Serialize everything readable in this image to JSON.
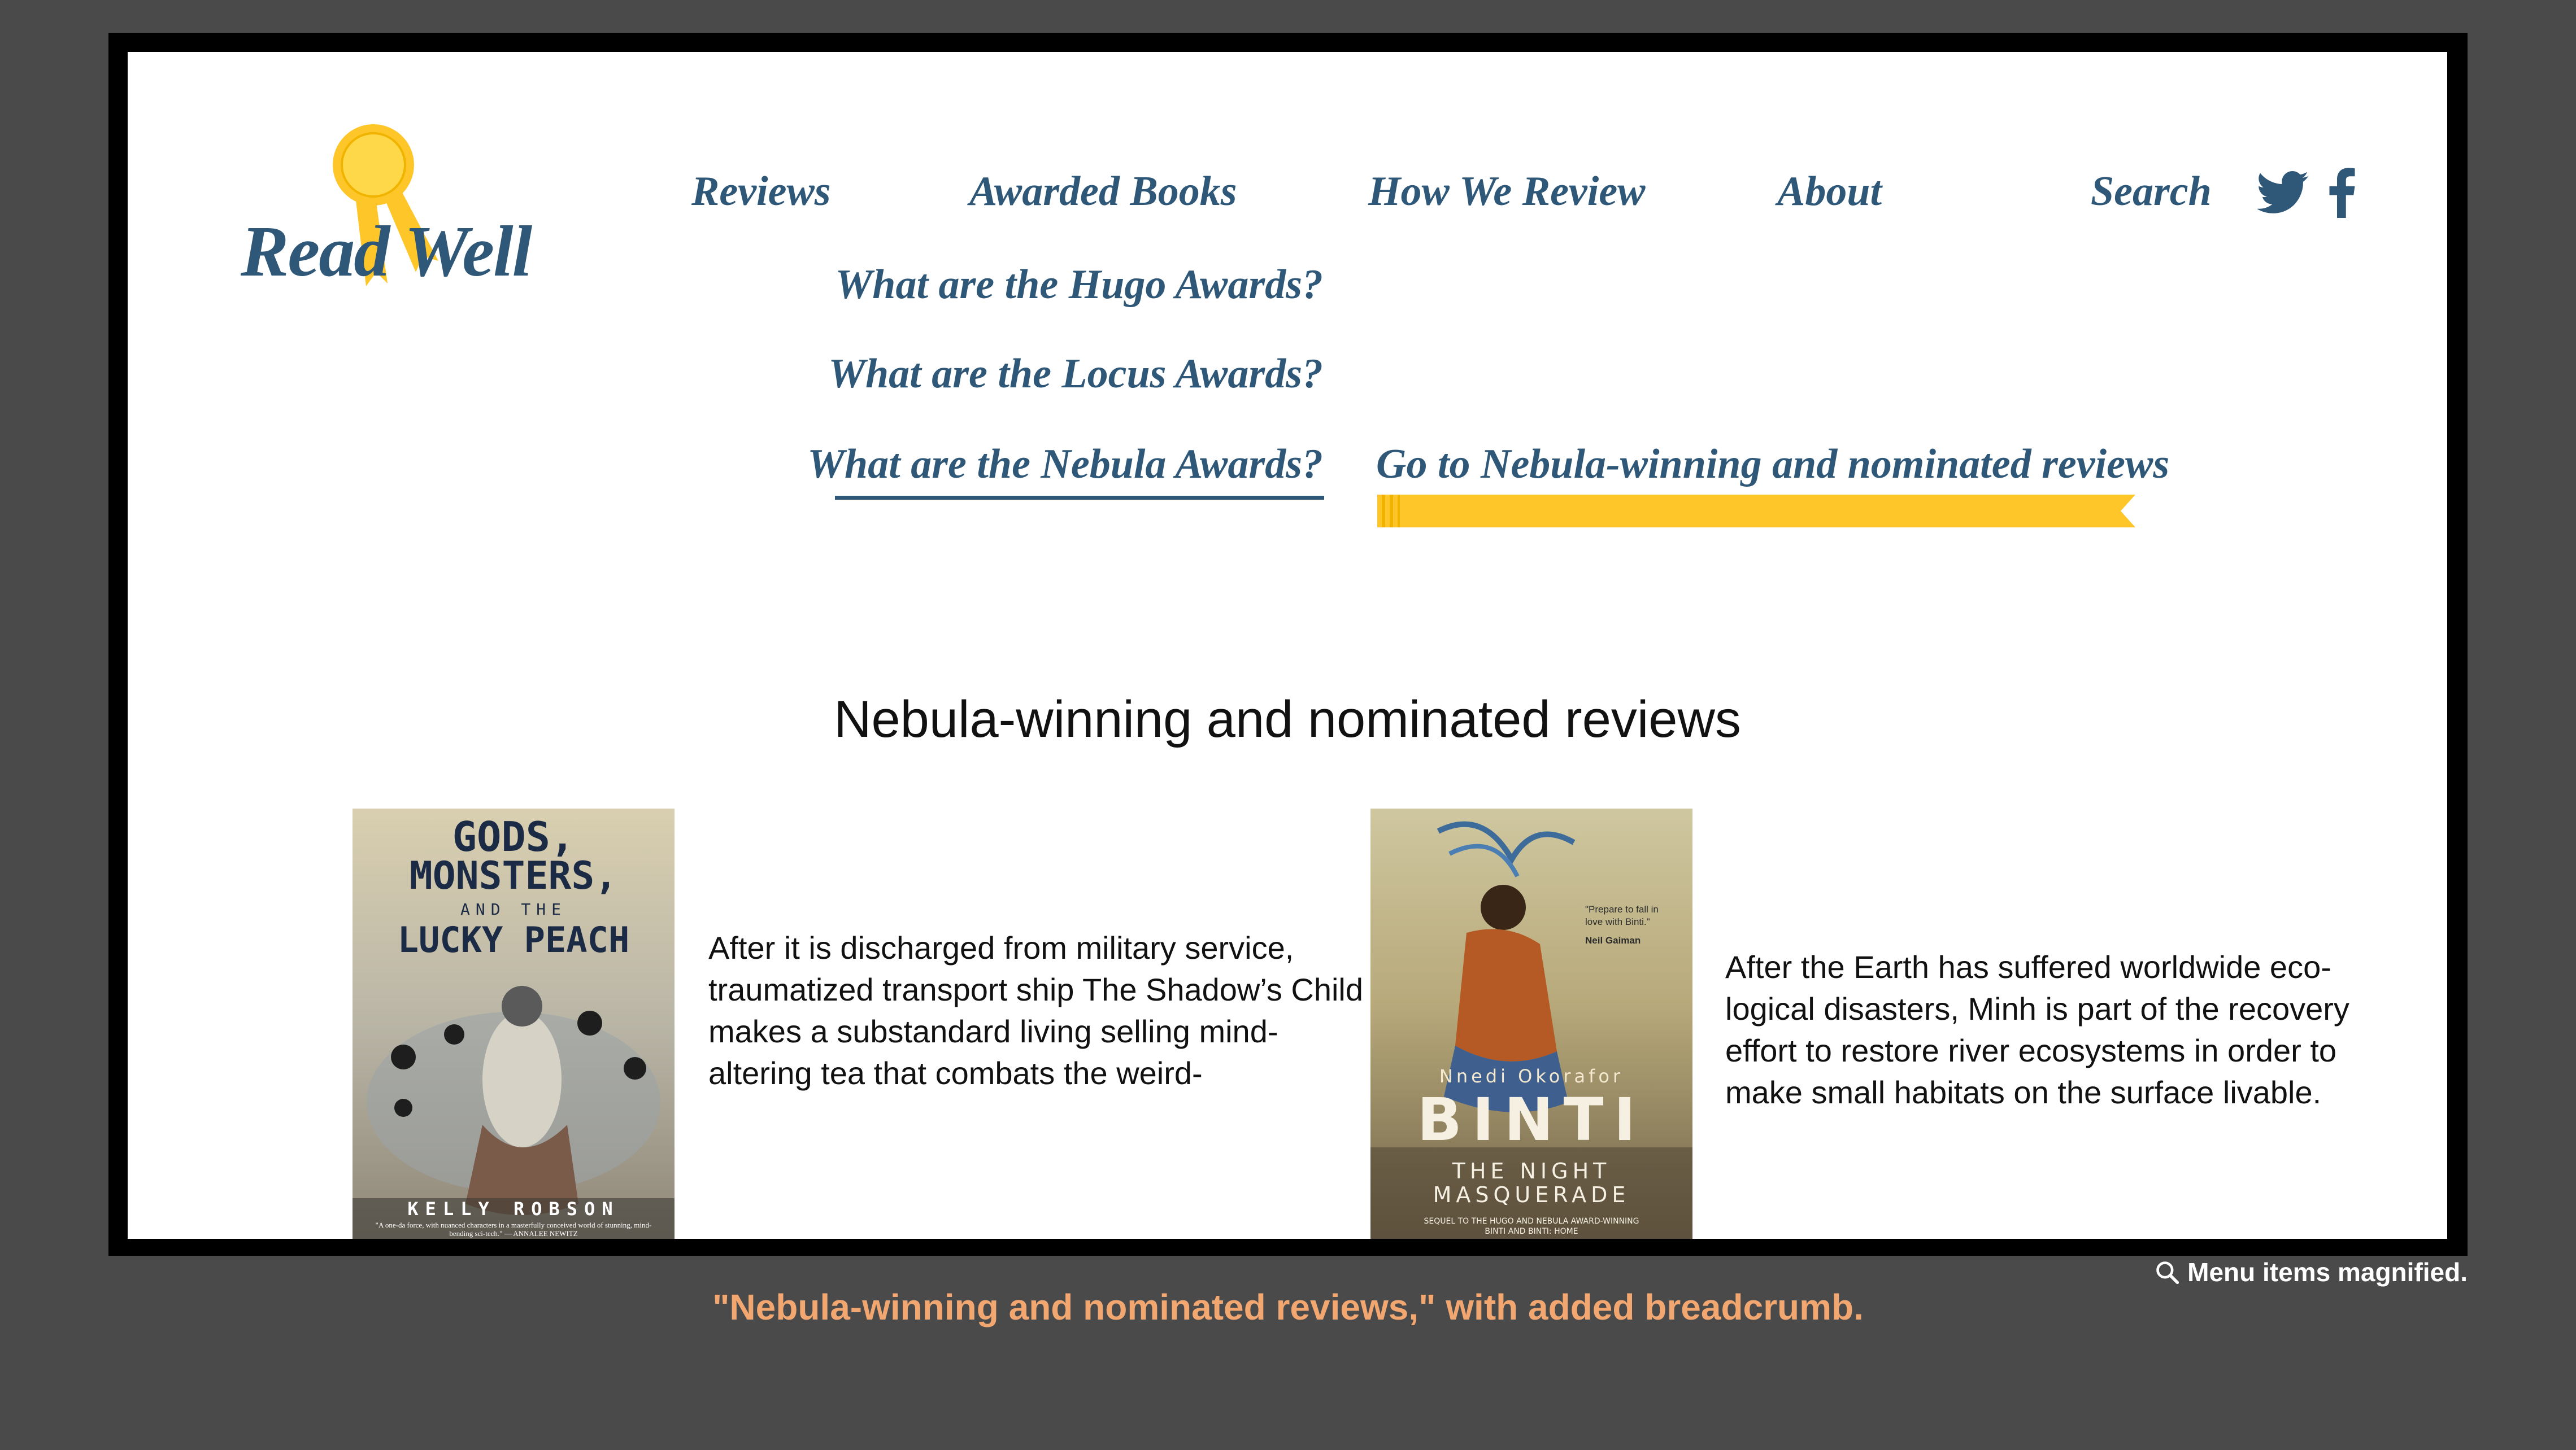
{
  "logo": {
    "text": "Read Well",
    "ribbon_color": "#ffc629"
  },
  "nav": {
    "items": [
      "Reviews",
      "Awarded Books",
      "How We Review",
      "About",
      "Search"
    ],
    "color": "#2f5777"
  },
  "submenu": {
    "items": [
      "What are the Hugo Awards?",
      "What are the Locus Awards?",
      "What are the Nebula Awards?"
    ],
    "active": "What are the Nebula Awards?"
  },
  "breadcrumb": {
    "label": "Go to Nebula-winning and nominated reviews",
    "color": "#ffc629"
  },
  "social": {
    "icons": [
      "twitter-icon",
      "facebook-icon"
    ]
  },
  "main": {
    "heading": "Nebula-winning and nominated reviews",
    "books": [
      {
        "cover_title": [
          "GODS,",
          "MONSTERS,",
          "AND THE",
          "LUCKY PEACH"
        ],
        "cover_author": "KELLY ROBSON",
        "cover_blurb": "\"A one-da force, with nuanced characters in a masterfully conceived world of stunning, mind-bending sci-tech.\" — ANNALEE NEWITZ",
        "excerpt": "After it is discharged from military service, traumatized transport ship The Shadow’s Child makes a substandard living selling mind-altering tea that combats the weird-"
      },
      {
        "cover_quote": "\"Prepare to fall in love with Binti.\"",
        "cover_quote_author": "Neil Gaiman",
        "cover_author": "Nnedi Okorafor",
        "cover_title": "BINTI",
        "cover_subtitle": [
          "THE NIGHT",
          "MASQUERADE"
        ],
        "cover_footer": "SEQUEL TO THE HUGO AND NEBULA AWARD-WINNING BINTI AND BINTI: HOME",
        "excerpt": "After the Earth has suffered worldwide eco-logical disasters, Minh is part of the recovery effort to restore river ecosystems in order to make small habitats on the surface livable."
      }
    ]
  },
  "annotation": {
    "caption": "\"Nebula-winning and nominated reviews,\" with added breadcrumb.",
    "note": "Menu items magnified."
  }
}
